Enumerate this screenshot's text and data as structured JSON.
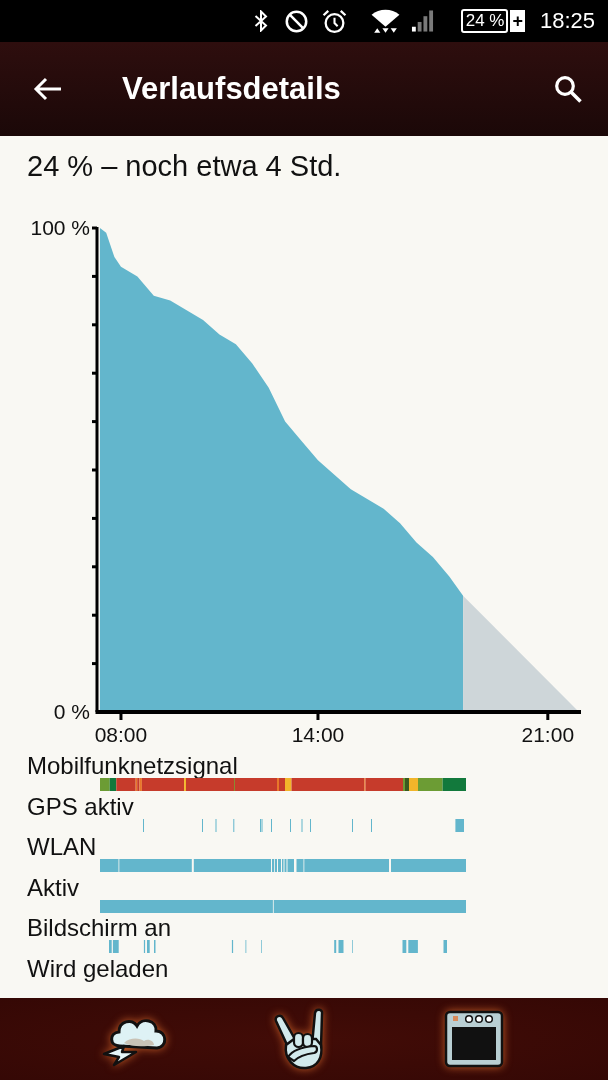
{
  "status_bar": {
    "battery": "24 %",
    "battery_sign": "+",
    "time": "18:25"
  },
  "app_bar": {
    "title": "Verlaufsdetails"
  },
  "summary": "24 % – noch etwa 4 Std.",
  "chart_data": {
    "type": "area",
    "x": [
      7.36,
      7.55,
      7.8,
      8.0,
      8.5,
      9.0,
      9.5,
      10.0,
      10.5,
      11.0,
      11.5,
      12.0,
      12.5,
      13.0,
      13.5,
      14.0,
      14.5,
      15.0,
      15.5,
      16.0,
      16.5,
      17.0,
      17.5,
      18.0,
      18.42,
      21.95
    ],
    "series": [
      {
        "color": "#63b6cc",
        "values": [
          100,
          99,
          94,
          92,
          90,
          86,
          85,
          83,
          81,
          78,
          76,
          72,
          67,
          60,
          56,
          52,
          49,
          46,
          44,
          42,
          39,
          35,
          32,
          28,
          24,
          null
        ]
      },
      {
        "color": "#ced6d9",
        "values": [
          null,
          null,
          null,
          null,
          null,
          null,
          null,
          null,
          null,
          null,
          null,
          null,
          null,
          null,
          null,
          null,
          null,
          null,
          null,
          null,
          null,
          null,
          null,
          null,
          24,
          0
        ]
      }
    ],
    "xlim": [
      7.27,
      21.95
    ],
    "ylim": [
      0,
      100
    ],
    "xticks": [
      {
        "value": 8,
        "label": "08:00"
      },
      {
        "value": 14,
        "label": "14:00"
      },
      {
        "value": 21,
        "label": "21:00"
      }
    ],
    "yticks": [
      {
        "value": 0,
        "label": "0 %"
      },
      {
        "value": 100,
        "label": "100 %"
      }
    ]
  },
  "timelines": [
    {
      "label": "Mobilfunknetzsignal",
      "kind": "signal"
    },
    {
      "label": "GPS aktiv",
      "kind": "gps"
    },
    {
      "label": "WLAN",
      "kind": "wlan"
    },
    {
      "label": "Aktiv",
      "kind": "awake"
    },
    {
      "label": "Bildschirm an",
      "kind": "screen"
    },
    {
      "label": "Wird geladen",
      "kind": "charging"
    }
  ]
}
